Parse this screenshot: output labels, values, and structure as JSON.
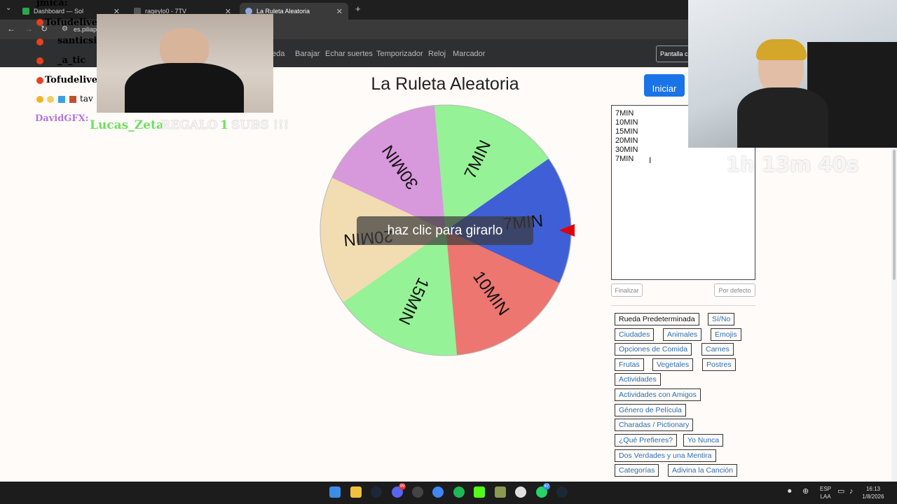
{
  "browser": {
    "tabs": [
      {
        "label": "Dashboard — Sol"
      },
      {
        "label": "rageylo0 - 7TV"
      },
      {
        "label": "La Ruleta Aleatoria"
      }
    ],
    "url": "es.piliap"
  },
  "nav": {
    "links": [
      "eda",
      "Barajar",
      "Echar suertes",
      "Temporizador",
      "Reloj",
      "Marcador"
    ],
    "button_label": "Pantalla c"
  },
  "main": {
    "title": "La Ruleta Aleatoria",
    "spin_hint": "haz clic para girarlo",
    "start_label": "Iniciar",
    "entries_text": "7MIN\n10MIN\n15MIN\n20MIN\n30MIN\n7MIN",
    "finalize_label": "Finalizar",
    "default_label": "Por defecto"
  },
  "wheel": {
    "segments": [
      {
        "label": "7MIN",
        "color": "#3f5fd6"
      },
      {
        "label": "10MIN",
        "color": "#ed7670"
      },
      {
        "label": "15MIN",
        "color": "#96f297"
      },
      {
        "label": "20MIN",
        "color": "#f2dcb2"
      },
      {
        "label": "30MIN",
        "color": "#d898dc"
      },
      {
        "label": "7MIN",
        "color": "#96f297"
      }
    ],
    "pointer_color": "#e00000"
  },
  "presets": [
    "Rueda Predeterminada",
    "Sí/No",
    "Ciudades",
    "Animales",
    "Emojis",
    "Opciones de Comida",
    "Carnes",
    "Frutas",
    "Vegetales",
    "Postres",
    "Actividades",
    "Actividades con Amigos",
    "Género de Película",
    "Charadas / Pictionary",
    "¿Qué Prefieres?",
    "Yo Nunca",
    "Dos Verdades y una Mentira",
    "Categorías",
    "Adivina la Canción"
  ],
  "overlay": {
    "chat": [
      {
        "name": "jmica:",
        "color": "#f0f0f0"
      },
      {
        "name": "Tofudelive",
        "color": "#e8401c"
      },
      {
        "name": "santicsi",
        "color": "#b6e39a"
      },
      {
        "name": "_a_tic",
        "color": "#b6e39a"
      },
      {
        "name": "Tofudelive",
        "color": "#e8401c"
      },
      {
        "name": "tav",
        "color": "#dddddd"
      }
    ],
    "gift_user": "DavidGFX:",
    "gift_name": "Lucas_Zeta",
    "gift_text": "REGALO",
    "gift_count": "1",
    "gift_suffix": "SUBS !!!",
    "timer": "1h 13m 40s"
  },
  "taskbar": {
    "lang_top": "ESP",
    "lang_bottom": "LAA",
    "time": "16:13",
    "date": "1/8/2026",
    "badge_discord": "99",
    "badge_whatsapp": "67"
  }
}
